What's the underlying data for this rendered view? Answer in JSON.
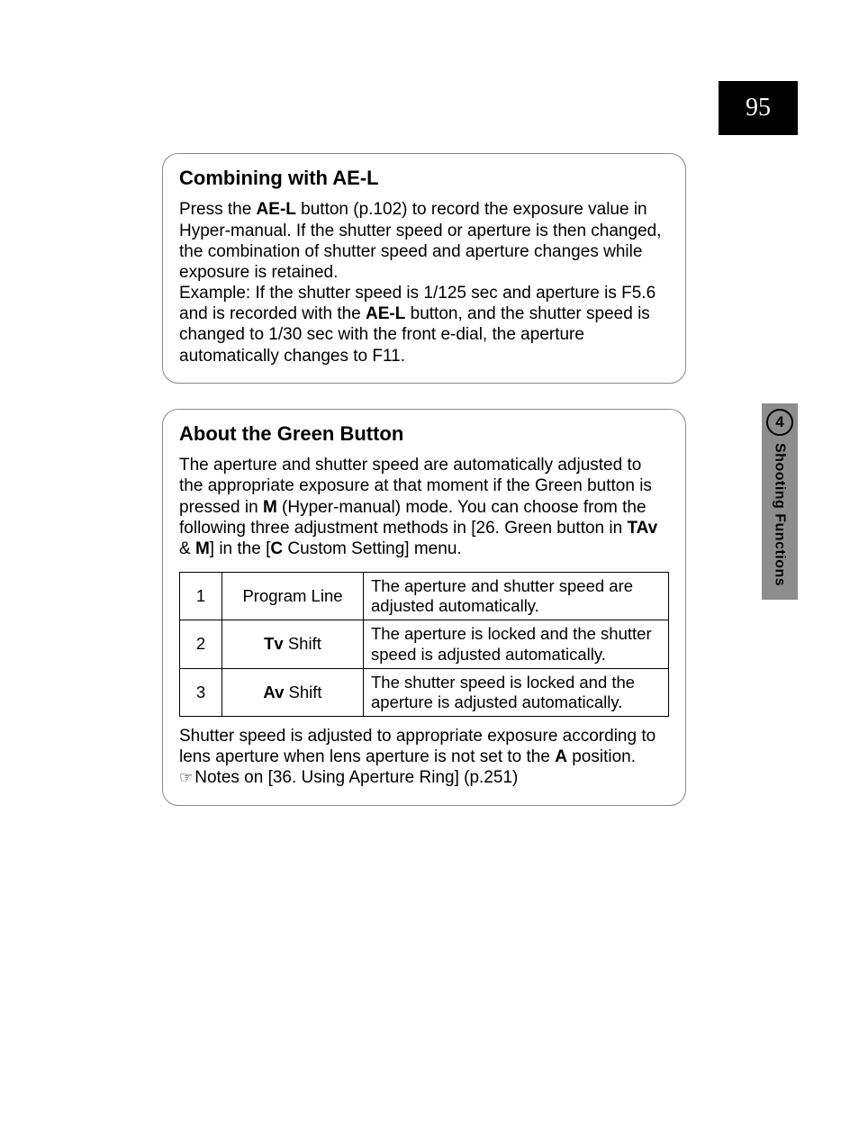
{
  "page_number": "95",
  "side_tab": {
    "chapter_number": "4",
    "chapter_title": "Shooting Functions"
  },
  "box1": {
    "heading_prefix": "Combining with ",
    "heading_bold": "AE-L",
    "p1a": "Press the ",
    "p1b": "AE-L",
    "p1c": " button (p.102) to record the exposure value in Hyper-manual. If the shutter speed or aperture is then changed, the combination of shutter speed and aperture changes while exposure is retained.",
    "p2a": "Example: If the shutter speed is 1/125 sec and aperture is F5.6 and is recorded with the ",
    "p2b": "AE-L",
    "p2c": " button, and the shutter speed is changed to 1/30 sec with the front e-dial, the aperture automatically changes to F11."
  },
  "box2": {
    "heading": "About the Green Button",
    "intro_a": "The aperture and shutter speed are automatically adjusted to the appropriate exposure at that moment if the Green button is pressed in ",
    "intro_M": "M",
    "intro_b": " (Hyper-manual) mode. You can choose from the following three adjustment methods in [26. Green button in ",
    "intro_TAv": "TAv",
    "intro_amp": " & ",
    "intro_M2": "M",
    "intro_c": "] in the [",
    "intro_C": "C",
    "intro_d": " Custom Setting] menu.",
    "rows": [
      {
        "num": "1",
        "name_bold": "",
        "name_plain": "Program Line",
        "desc": "The aperture and shutter speed are adjusted automatically."
      },
      {
        "num": "2",
        "name_bold": "Tv",
        "name_plain": " Shift",
        "desc": "The aperture is locked and the shutter speed is adjusted automatically."
      },
      {
        "num": "3",
        "name_bold": "Av",
        "name_plain": " Shift",
        "desc": "The shutter speed is locked and the aperture is adjusted automatically."
      }
    ],
    "after_a": "Shutter speed is adjusted to appropriate exposure according to lens aperture when lens aperture is not set to the ",
    "after_A": "A",
    "after_b": " position.",
    "note_icon": "☞",
    "note_text": "Notes on [36. Using Aperture Ring] (p.251)"
  }
}
